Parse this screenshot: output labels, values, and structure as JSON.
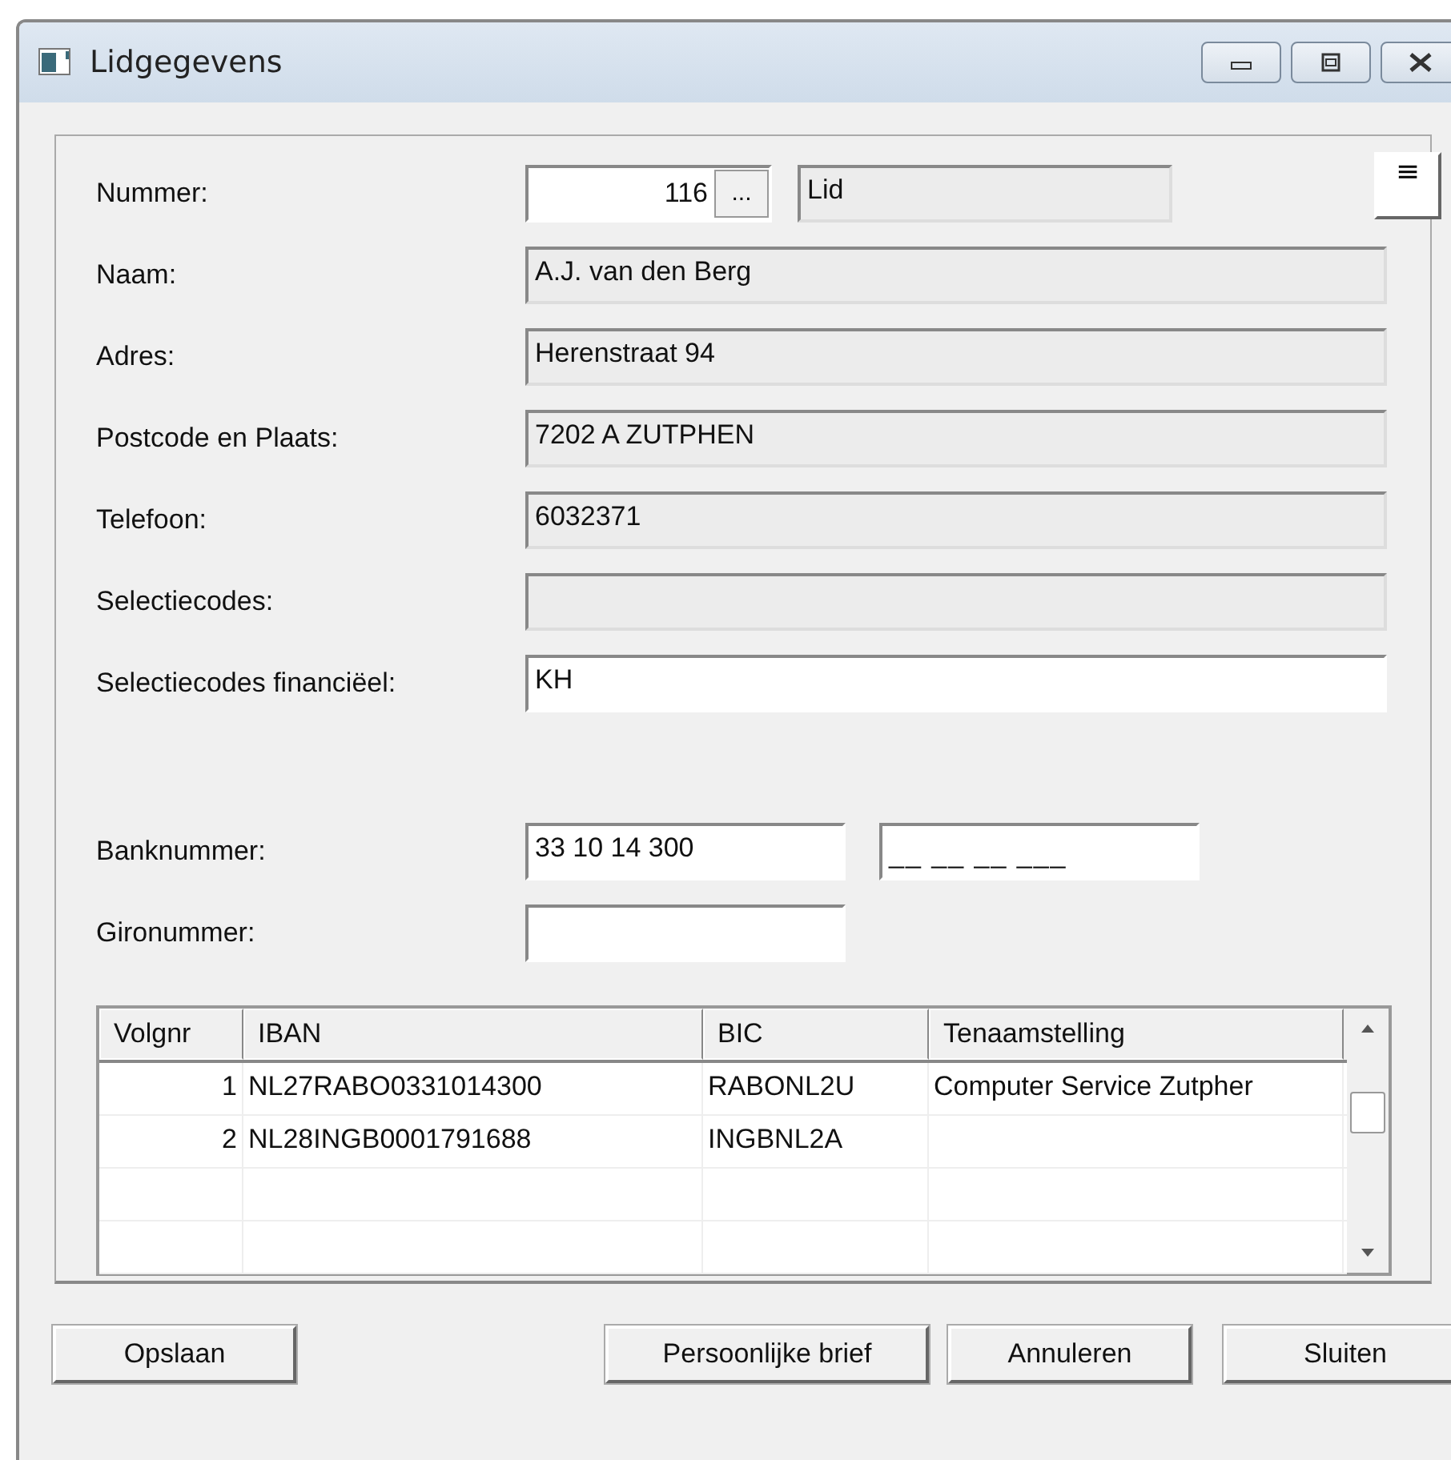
{
  "window": {
    "title": "Lidgegevens"
  },
  "form": {
    "nummer": {
      "label": "Nummer:",
      "value": "116",
      "browse": "...",
      "type_value": "Lid",
      "menu": "≡"
    },
    "fields": [
      {
        "label": "Naam:",
        "value": "A.J. van den Berg",
        "readonly": true
      },
      {
        "label": "Adres:",
        "value": "Herenstraat 94",
        "readonly": true
      },
      {
        "label": "Postcode en Plaats:",
        "value": "7202 A ZUTPHEN",
        "readonly": true
      },
      {
        "label": "Telefoon:",
        "value": "6032371",
        "readonly": true
      },
      {
        "label": "Selectiecodes:",
        "readonly": true
      },
      {
        "label": "Selectiecodes financiëel:",
        "value": "KH",
        "readonly": false
      }
    ],
    "bank": {
      "label": "Banknummer:",
      "value": "33 10 14 300",
      "mask": "__ __ __ ___"
    },
    "giro": {
      "label": "Gironummer:"
    }
  },
  "table": {
    "columns": [
      "Volgnr",
      "IBAN",
      "BIC",
      "Tenaamstelling"
    ],
    "rows": [
      {
        "volgnr": "1",
        "iban": "NL27RABO0331014300",
        "bic": "RABONL2U",
        "tenaamstelling": "Computer Service Zutpher"
      },
      {
        "volgnr": "2",
        "iban": "NL28INGB0001791688",
        "bic": "INGBNL2A"
      }
    ]
  },
  "buttons": [
    "Opslaan",
    "Persoonlijke brief",
    "Annuleren",
    "Sluiten"
  ]
}
